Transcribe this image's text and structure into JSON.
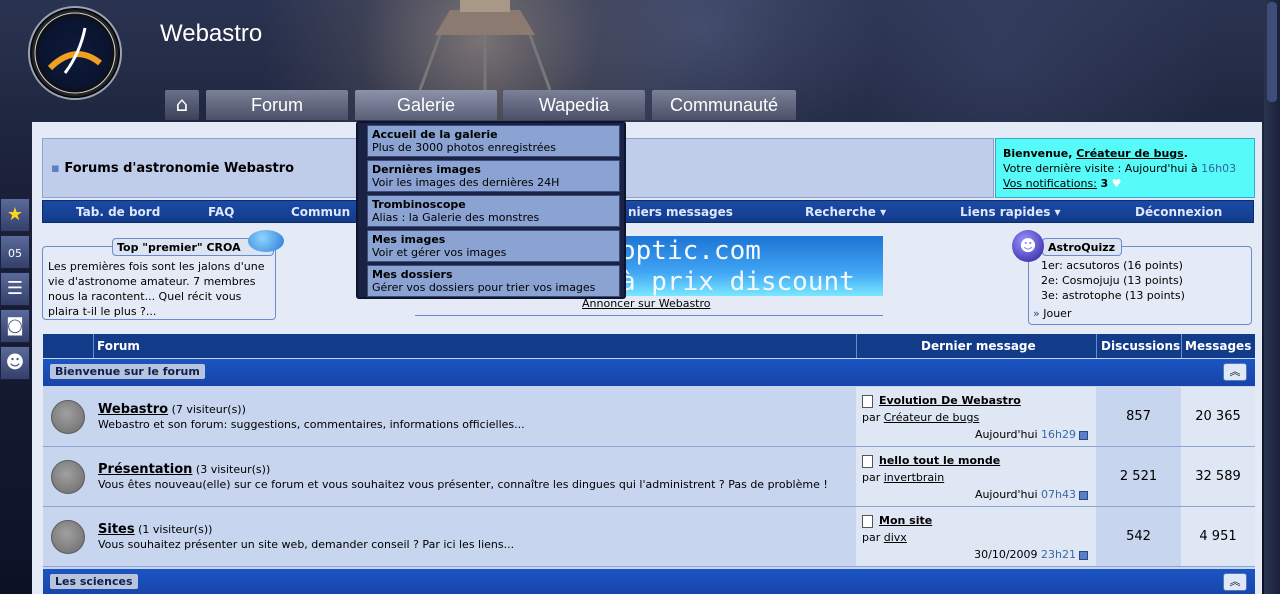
{
  "site": {
    "title": "Webastro"
  },
  "topnav": {
    "home_icon": "home-icon",
    "tabs": [
      "Forum",
      "Galerie",
      "Wapedia",
      "Communauté"
    ]
  },
  "breadcrumb": {
    "title": "Forums d'astronomie Webastro"
  },
  "welcome": {
    "greeting": "Bienvenue, ",
    "user": "Créateur de bugs",
    "last_visit_label": "Votre dernière visite : Aujourd'hui à ",
    "last_visit_time": "16h03",
    "notifications_label": "Vos notifications:",
    "notifications_count": "3"
  },
  "menubar": {
    "items": [
      "Tab. de bord",
      "FAQ",
      "Commun",
      "niers messages",
      "Recherche ▾",
      "Liens rapides ▾",
      "Déconnexion"
    ]
  },
  "top_premier": {
    "title": "Top \"premier\" CROA",
    "text": "Les premières fois sont les jalons d'une vie d'astronome amateur. 7 membres nous la racontent... Quel récit vous plaira t-il le plus ?..."
  },
  "banner": {
    "line1": "optic.com",
    "line2": "à prix discount",
    "advert": "Annoncer sur Webastro"
  },
  "astroquizz": {
    "title": "AstroQuizz",
    "ranks": [
      "1er: acsutoros (16 points)",
      "2e: Cosmojuju (13 points)",
      "3e: astrotophe (13 points)"
    ],
    "play": "Jouer"
  },
  "dropdown": {
    "items": [
      {
        "title": "Accueil de la galerie",
        "desc": "Plus de 3000 photos enregistrées"
      },
      {
        "title": "Dernières images",
        "desc": "Voir les images des dernières 24H"
      },
      {
        "title": "Trombinoscope",
        "desc": "Alias : la Galerie des monstres"
      },
      {
        "title": "Mes images",
        "desc": "Voir et gérer vos images"
      },
      {
        "title": "Mes dossiers",
        "desc": "Gérer vos dossiers pour trier vos images"
      }
    ]
  },
  "forum_table": {
    "headers": {
      "forum": "Forum",
      "last": "Dernier message",
      "discussions": "Discussions",
      "messages": "Messages"
    },
    "cat1": "Bienvenue sur le forum",
    "cat2": "Les sciences",
    "rows": [
      {
        "name": "Webastro",
        "visitors": " (7 visiteur(s))",
        "desc": "Webastro et son forum: suggestions, commentaires, informations officielles...",
        "last_title": "Evolution De Webastro",
        "by": "par ",
        "last_user": "Créateur de bugs",
        "last_day": "Aujourd'hui ",
        "last_time": "16h29",
        "discussions": "857",
        "messages": "20 365"
      },
      {
        "name": "Présentation",
        "visitors": " (3 visiteur(s))",
        "desc": "Vous êtes nouveau(elle) sur ce forum et vous souhaitez vous présenter, connaître les dingues qui l'administrent ? Pas de problème !",
        "last_title": "hello tout le monde",
        "by": "par ",
        "last_user": "invertbrain",
        "last_day": "Aujourd'hui ",
        "last_time": "07h43",
        "discussions": "2 521",
        "messages": "32 589"
      },
      {
        "name": "Sites",
        "visitors": " (1 visiteur(s))",
        "desc": "Vous souhaitez présenter un site web, demander conseil ? Par ici les liens...",
        "last_title": "Mon site",
        "by": "par ",
        "last_user": "divx",
        "last_day": "30/10/2009 ",
        "last_time": "23h21",
        "discussions": "542",
        "messages": "4 951"
      }
    ]
  }
}
